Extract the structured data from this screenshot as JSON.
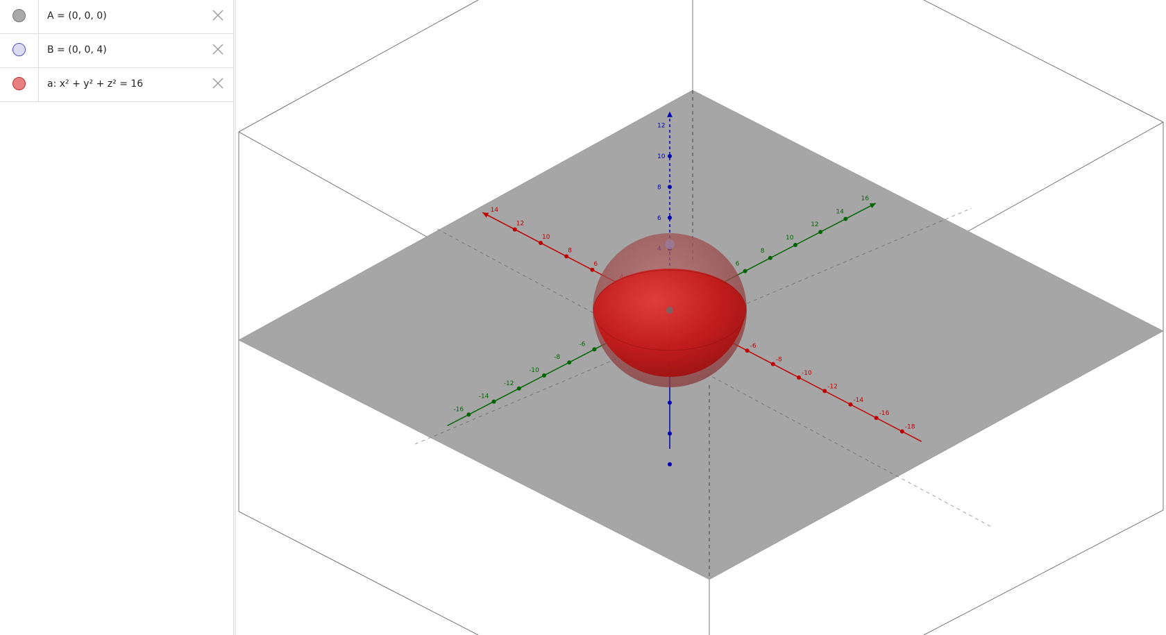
{
  "algebra": {
    "rows": [
      {
        "label": "A = (0, 0, 0)",
        "marble_color": "#a8a8a8",
        "marble_border": "#777777"
      },
      {
        "label": "B = (0, 0, 4)",
        "marble_color": "#dcdcf0",
        "marble_border": "#5050c0"
      },
      {
        "label": "a: x² + y² + z² = 16",
        "marble_color": "#e88080",
        "marble_border": "#b03030"
      }
    ],
    "delete_icon": "close-icon"
  },
  "graphics": {
    "axes_colors": {
      "x": "#c00000",
      "y": "#006400",
      "z": "#0000b0"
    },
    "plane_color": "#a6a6a6",
    "sphere_color": "#cc2020",
    "x_axis_labels": [
      "14",
      "12",
      "10",
      "8",
      "6",
      "4",
      "-6",
      "-8",
      "-10",
      "-12",
      "-14",
      "-16",
      "-18"
    ],
    "y_axis_labels": [
      "6",
      "8",
      "10",
      "12",
      "14",
      "16",
      "-6",
      "-8",
      "-10",
      "-12",
      "-14",
      "-16"
    ],
    "z_axis_labels": [
      "12",
      "10",
      "8",
      "6",
      "4"
    ]
  }
}
